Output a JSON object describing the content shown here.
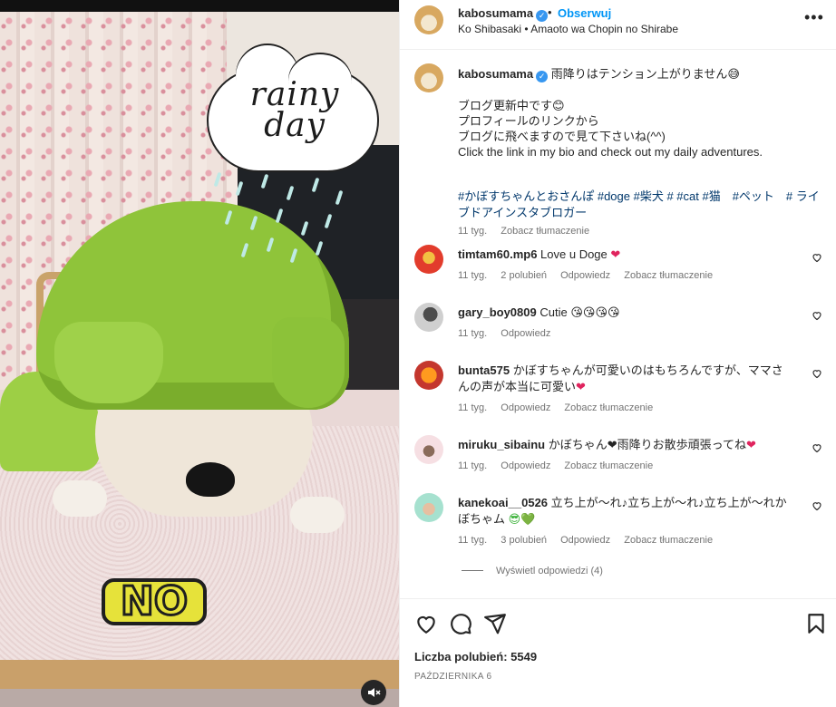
{
  "post": {
    "username": "kabosumama",
    "follow_label": "Obserwuj",
    "separator": "•",
    "audio": "Ko Shibasaki • Amaoto wa Chopin no Shirabe",
    "more": "•••"
  },
  "media": {
    "sticker_top": "rainy day",
    "sticker_bottom": "NO"
  },
  "caption": {
    "username": "kabosumama",
    "lines": [
      "雨降りはテンション上がりません😅",
      "",
      "ブログ更新中です😊",
      "プロフィールのリンクから",
      "ブログに飛べますので見て下さいね(^^)",
      "Click the link in my bio and check out my daily adventures."
    ],
    "tags": "#かぼすちゃんとおさんぽ #doge #柴犬 # #cat #猫　#ペット　# ライブドアインスタブロガー",
    "time": "11 tyg.",
    "translate": "Zobacz tłumaczenie"
  },
  "comments": [
    {
      "user": "timtam60.mp6",
      "text": "Love u Doge",
      "suffix": "❤",
      "time": "11 tyg.",
      "likes": "2 polubień",
      "reply": "Odpowiedz",
      "translate": "Zobacz tłumaczenie"
    },
    {
      "user": "gary_boy0809",
      "text": "Cutie",
      "suffix": "😘😘😘😘",
      "time": "11 tyg.",
      "reply": "Odpowiedz"
    },
    {
      "user": "bunta575",
      "text": "かぼすちゃんが可愛いのはもちろんですが、ママさんの声が本当に可愛い",
      "suffix": "❤",
      "time": "11 tyg.",
      "reply": "Odpowiedz",
      "translate": "Zobacz tłumaczenie"
    },
    {
      "user": "miruku_sibainu",
      "text": "かぼちゃん❤雨降りお散歩頑張ってね",
      "suffix": "❤",
      "time": "11 tyg.",
      "reply": "Odpowiedz",
      "translate": "Zobacz tłumaczenie"
    },
    {
      "user": "kanekoai__0526",
      "text": "立ち上が～れ♪立ち上が～れ♪立ち上が～れかぼちゃム",
      "suffix": "😎💚",
      "time": "11 tyg.",
      "likes": "3 polubień",
      "reply": "Odpowiedz",
      "translate": "Zobacz tłumaczenie"
    }
  ],
  "view_replies": "Wyświetl odpowiedzi (4)",
  "footer": {
    "likes": "Liczba polubień: 5549",
    "date": "PAŹDZIERNIKA 6"
  },
  "icons": [
    "heart-icon",
    "comment-icon",
    "share-icon",
    "bookmark-icon",
    "more-icon",
    "mute-icon",
    "verified-icon"
  ],
  "colors": {
    "link": "#0095f6",
    "hashtag": "#00376b",
    "verified": "#3797f0",
    "meta": "#737373"
  }
}
